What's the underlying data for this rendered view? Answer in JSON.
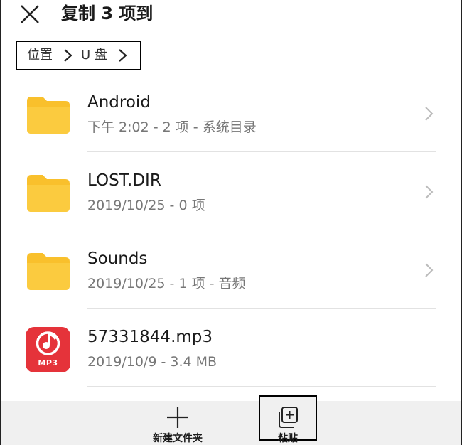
{
  "header": {
    "title": "复制 3 项到"
  },
  "breadcrumb": {
    "items": [
      "位置",
      "U 盘"
    ]
  },
  "files": [
    {
      "name": "Android",
      "meta": "下午 2:02 - 2 项 - 系统目录",
      "type": "folder"
    },
    {
      "name": "LOST.DIR",
      "meta": "2019/10/25 - 0 项",
      "type": "folder"
    },
    {
      "name": "Sounds",
      "meta": "2019/10/25 - 1 项 - 音频",
      "type": "folder"
    },
    {
      "name": "57331844.mp3",
      "meta": "2019/10/9 - 3.4 MB",
      "type": "mp3",
      "badge": "MP3"
    }
  ],
  "actions": {
    "new_folder": "新建文件夹",
    "paste": "粘贴"
  },
  "colors": {
    "folder": "#f9c02c",
    "folder_tab": "#fbd466",
    "mp3": "#e5333a",
    "bottom_bar": "#f0f0f0"
  }
}
